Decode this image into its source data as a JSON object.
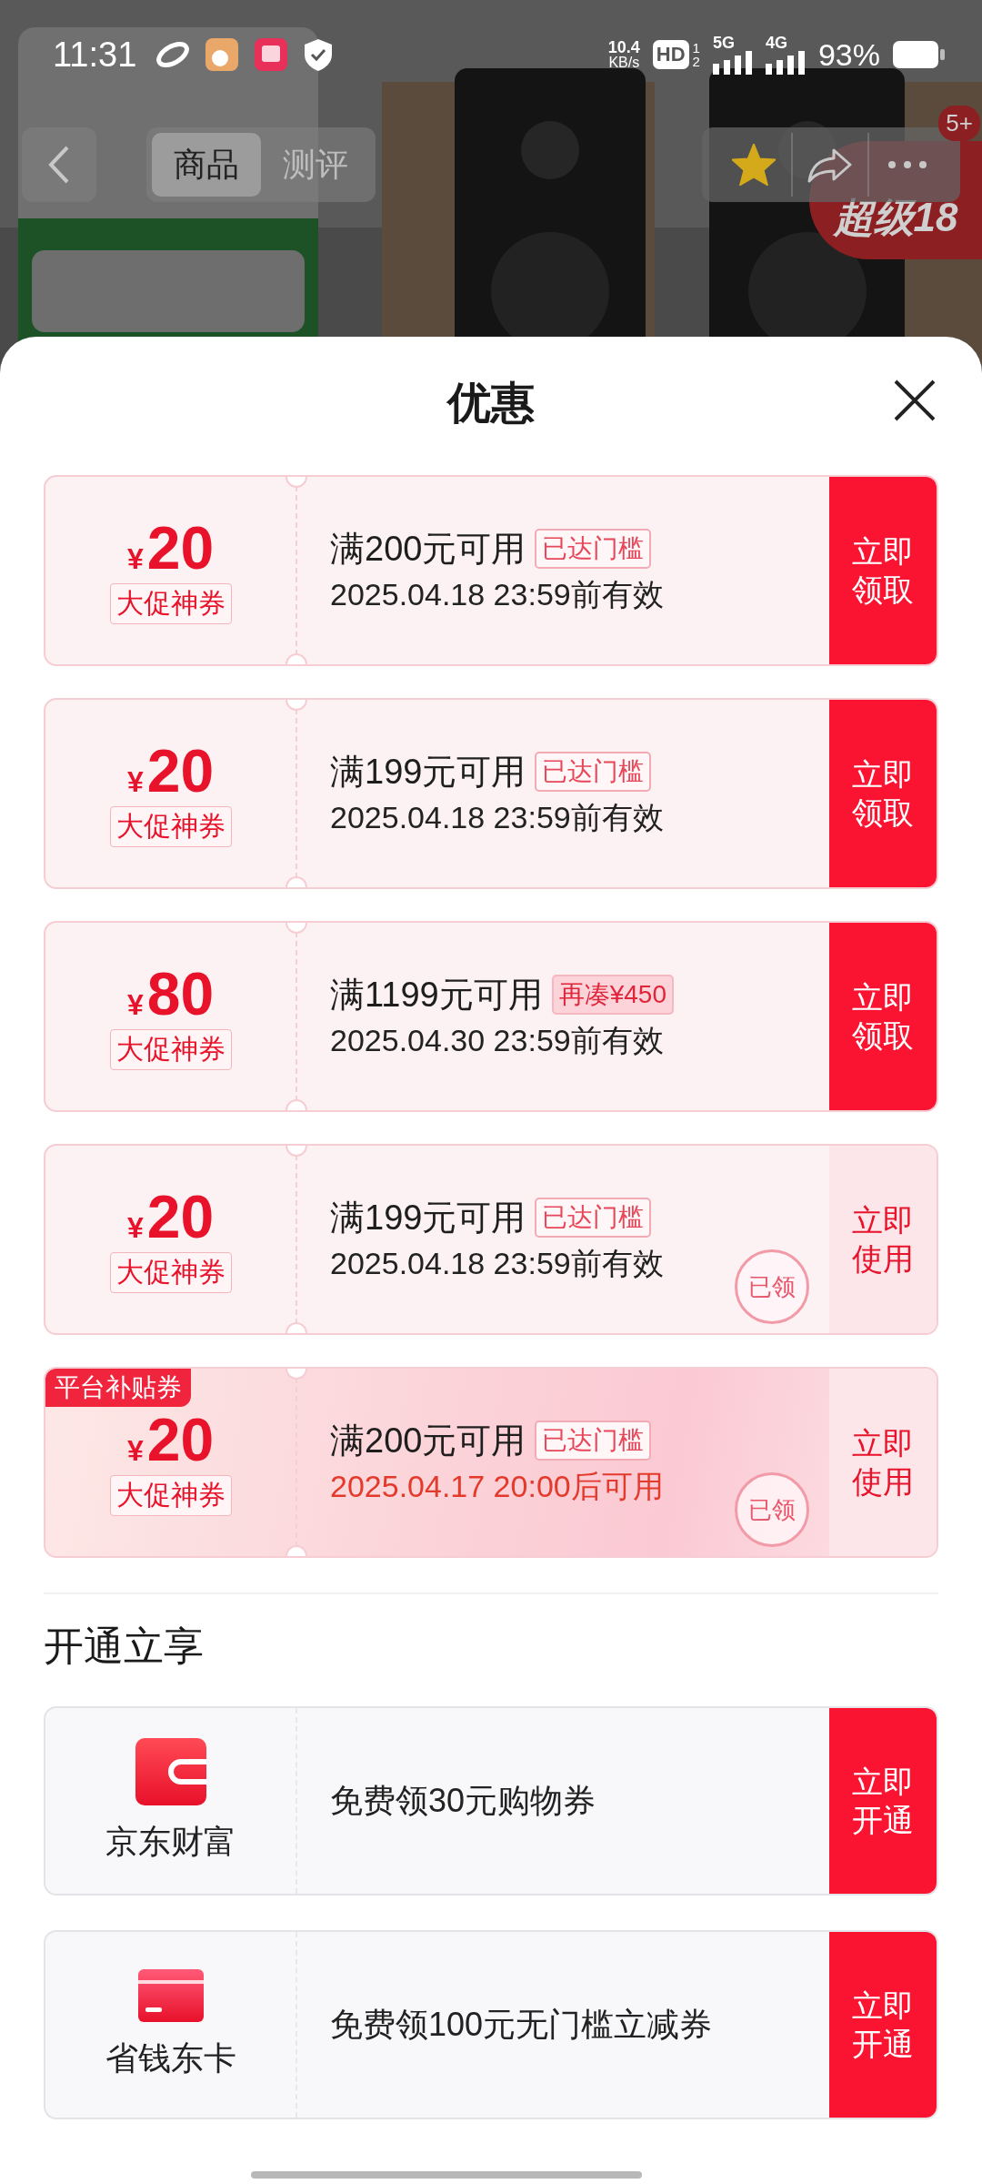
{
  "status_bar": {
    "time": "11:31",
    "net_speed": "10.4",
    "net_unit": "KB/s",
    "hd": "HD",
    "hd_sims": [
      "1",
      "2"
    ],
    "networks": [
      "5G",
      "4G"
    ],
    "battery": "93%"
  },
  "nav": {
    "tabs": [
      {
        "label": "商品",
        "selected": true
      },
      {
        "label": "测评",
        "selected": false
      }
    ],
    "favorited": true,
    "badge": "5+",
    "promo": "超级18"
  },
  "sheet": {
    "title": "优惠",
    "coupons": [
      {
        "kind": "standard",
        "currency": "¥",
        "amount": "20",
        "label": "大促神券",
        "condition": "满200元可用",
        "tag": {
          "text": "已达门槛",
          "kind": "met"
        },
        "date": "2025.04.18 23:59前有效",
        "date_highlight": false,
        "claimed": false,
        "action": "立即领取"
      },
      {
        "kind": "standard",
        "currency": "¥",
        "amount": "20",
        "label": "大促神券",
        "condition": "满199元可用",
        "tag": {
          "text": "已达门槛",
          "kind": "met"
        },
        "date": "2025.04.18 23:59前有效",
        "date_highlight": false,
        "claimed": false,
        "action": "立即领取"
      },
      {
        "kind": "standard",
        "currency": "¥",
        "amount": "80",
        "label": "大促神券",
        "condition": "满1199元可用",
        "tag": {
          "text": "再凑¥450",
          "kind": "short"
        },
        "date": "2025.04.30 23:59前有效",
        "date_highlight": false,
        "claimed": false,
        "action": "立即领取"
      },
      {
        "kind": "standard",
        "currency": "¥",
        "amount": "20",
        "label": "大促神券",
        "condition": "满199元可用",
        "tag": {
          "text": "已达门槛",
          "kind": "met"
        },
        "date": "2025.04.18 23:59前有效",
        "date_highlight": false,
        "claimed": true,
        "stamp": "已领",
        "action": "立即使用"
      },
      {
        "kind": "platform",
        "corner_tag": "平台补贴券",
        "currency": "¥",
        "amount": "20",
        "label": "大促神券",
        "condition": "满200元可用",
        "tag": {
          "text": "已达门槛",
          "kind": "met"
        },
        "date": "2025.04.17 20:00后可用",
        "date_highlight": true,
        "claimed": true,
        "stamp": "已领",
        "action": "立即使用"
      }
    ],
    "section_title": "开通立享",
    "services": [
      {
        "name": "京东财富",
        "description": "免费领30元购物券",
        "action": "立即开通"
      },
      {
        "name": "省钱东卡",
        "description": "免费领100元无门槛立减券",
        "action": "立即开通"
      }
    ]
  }
}
